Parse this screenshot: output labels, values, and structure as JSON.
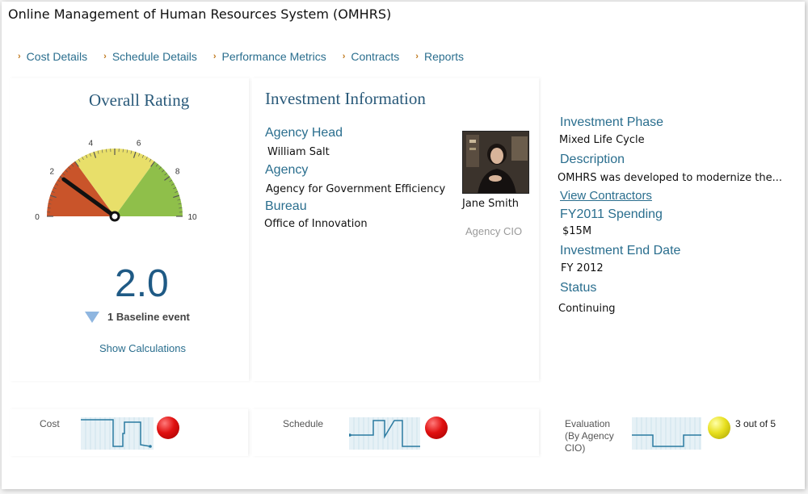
{
  "window": {
    "title": "Online Management of Human Resources System (OMHRS)"
  },
  "nav": {
    "items": [
      {
        "label": "Cost Details"
      },
      {
        "label": "Schedule Details"
      },
      {
        "label": "Performance Metrics"
      },
      {
        "label": "Contracts"
      },
      {
        "label": "Reports"
      }
    ]
  },
  "rating": {
    "heading": "Overall Rating",
    "gauge_ticks": [
      "0",
      "2",
      "4",
      "6",
      "8",
      "10"
    ],
    "gauge_value": 2.0,
    "value_text": "2.0",
    "baseline_text": "1 Baseline event",
    "show_calc": "Show Calculations",
    "colors": {
      "low": "#c9542a",
      "mid": "#e8df6a",
      "high": "#8fbf4a",
      "needle": "#111111"
    }
  },
  "investment": {
    "heading": "Investment Information",
    "agency_head_label": "Agency Head",
    "agency_head_value": "William Salt",
    "agency_label": "Agency",
    "agency_value": "Agency for Government Efficiency",
    "bureau_label": "Bureau",
    "bureau_value": "Office of Innovation",
    "cio_name": "Jane Smith",
    "cio_role": "Agency CIO"
  },
  "details": {
    "phase_label": "Investment Phase",
    "phase_value": "Mixed Life Cycle",
    "description_label": "Description",
    "description_value": "OMHRS was developed to modernize the...",
    "view_contractors": "View Contractors",
    "spending_label": "FY2011 Spending",
    "spending_value": "$15M",
    "end_date_label": "Investment End Date",
    "end_date_value": "FY 2012",
    "status_label": "Status",
    "status_value": "Continuing"
  },
  "bottom": {
    "cost_label": "Cost",
    "cost_status": "red",
    "schedule_label": "Schedule",
    "schedule_status": "red",
    "evaluation_label_1": "Evaluation",
    "evaluation_label_2": "(By Agency",
    "evaluation_label_3": "CIO)",
    "evaluation_status": "yellow",
    "evaluation_score": "3 out of 5"
  }
}
